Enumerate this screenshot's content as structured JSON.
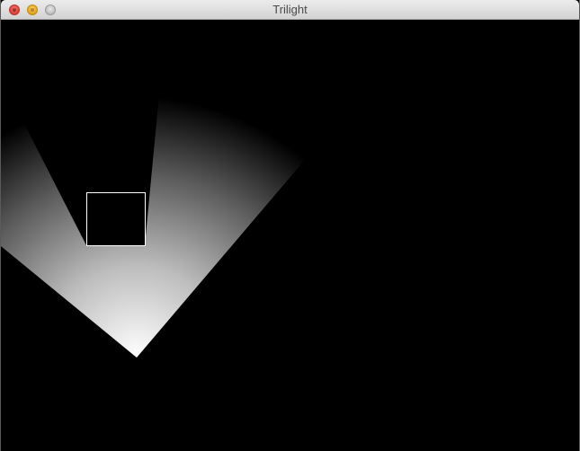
{
  "window": {
    "title": "Trilight",
    "controls": {
      "close": "close-icon",
      "minimize": "minimize-icon",
      "zoom": "zoom-icon"
    },
    "colors": {
      "close": "#e0443e",
      "minimize": "#e5a823",
      "zoom": "#bdbdbd"
    }
  },
  "scene": {
    "background": "#000000",
    "light_color": "#ffffff",
    "occluder_stroke": "#ffffff"
  }
}
